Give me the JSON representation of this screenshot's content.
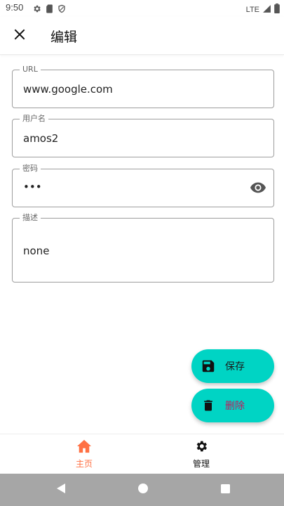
{
  "status_bar": {
    "time": "9:50",
    "network": "LTE",
    "icons": [
      "gear-icon",
      "sd-card-icon",
      "shield-icon",
      "signal-icon",
      "battery-icon"
    ]
  },
  "app_bar": {
    "title": "编辑",
    "close_icon": "close-icon"
  },
  "form": {
    "url": {
      "label": "URL",
      "value": "www.google.com"
    },
    "username": {
      "label": "用户名",
      "value": "amos2"
    },
    "password": {
      "label": "密码",
      "value": "•••",
      "toggle_icon": "eye-icon"
    },
    "description": {
      "label": "描述",
      "value": "none"
    }
  },
  "actions": {
    "save": {
      "label": "保存",
      "icon": "save-icon",
      "label_color": "#1a1a1a"
    },
    "delete": {
      "label": "删除",
      "icon": "trash-icon",
      "label_color": "#c2185b"
    },
    "fab_color": "#00d4c4"
  },
  "bottom_nav": {
    "items": [
      {
        "label": "主页",
        "icon": "home-icon",
        "active": true,
        "color": "#ff7043"
      },
      {
        "label": "管理",
        "icon": "settings-icon",
        "active": false,
        "color": "#111111"
      }
    ]
  },
  "system_nav": {
    "buttons": [
      "back-icon",
      "home-circle-icon",
      "recents-icon"
    ]
  }
}
